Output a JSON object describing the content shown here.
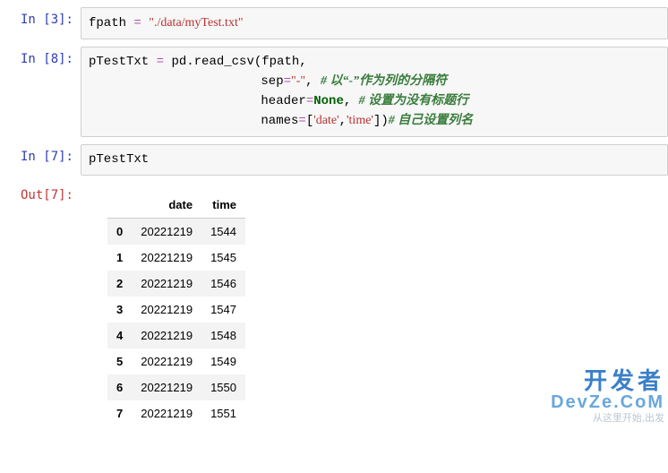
{
  "cells": {
    "c1": {
      "prompt": "In [3]:",
      "var": "fpath",
      "op": "=",
      "str": "\"./data/myTest.txt\""
    },
    "c2": {
      "prompt": "In [8]:",
      "l1_var": "pTestTxt",
      "l1_op": "=",
      "l1_call": "pd.read_csv(fpath,",
      "l2_kw": "sep",
      "l2_eq": "=",
      "l2_val": "\"-\"",
      "l2_comma": ",",
      "l2_comment": "# 以“-”作为列的分隔符",
      "l3_kw": "header",
      "l3_eq": "=",
      "l3_val": "None",
      "l3_comma": ",",
      "l3_comment": "# 设置为没有标题行",
      "l4_kw": "names",
      "l4_eq": "=",
      "l4_open": "[",
      "l4_s1": "'date'",
      "l4_c": ",",
      "l4_s2": "'time'",
      "l4_close": "])",
      "l4_comment": "# 自己设置列名"
    },
    "c3": {
      "prompt": "In [7]:",
      "code": "pTestTxt"
    },
    "out": {
      "prompt": "Out[7]:",
      "columns": [
        "date",
        "time"
      ],
      "index": [
        "0",
        "1",
        "2",
        "3",
        "4",
        "5",
        "6",
        "7"
      ],
      "rows": [
        [
          "20221219",
          "1544"
        ],
        [
          "20221219",
          "1545"
        ],
        [
          "20221219",
          "1546"
        ],
        [
          "20221219",
          "1547"
        ],
        [
          "20221219",
          "1548"
        ],
        [
          "20221219",
          "1549"
        ],
        [
          "20221219",
          "1550"
        ],
        [
          "20221219",
          "1551"
        ]
      ]
    }
  },
  "watermark": {
    "line1": "开发者",
    "line2": "DevZe.CoM",
    "line3": "从这里开始,出发"
  }
}
